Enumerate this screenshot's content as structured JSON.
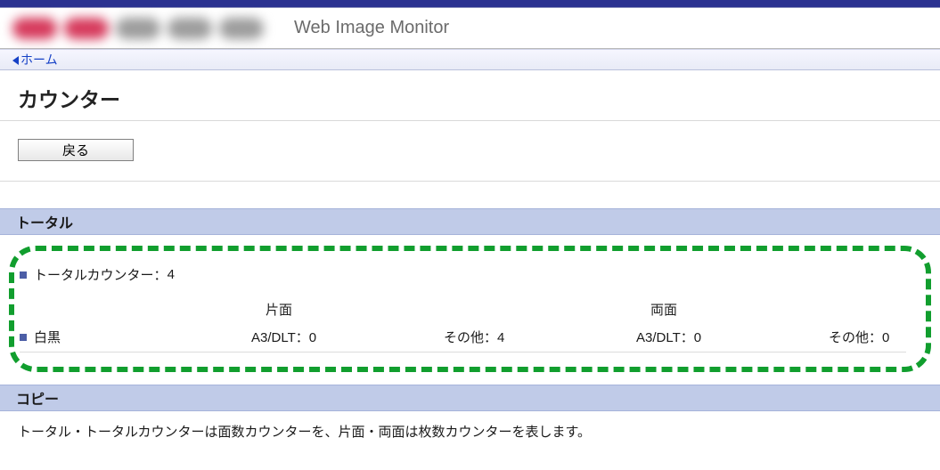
{
  "header": {
    "app_title": "Web Image Monitor"
  },
  "breadcrumb": {
    "home": "ホーム"
  },
  "page": {
    "title": "カウンター",
    "back_button": "戻る"
  },
  "sections": {
    "total": {
      "title": "トータル",
      "total_counter_label": "トータルカウンター：",
      "total_counter_value": "4",
      "col_simplex": "片面",
      "col_duplex": "両面",
      "row_bw_label": "白黒",
      "row_bw": {
        "simplex_a3": "A3/DLT：0",
        "simplex_other": "その他：4",
        "duplex_a3": "A3/DLT：0",
        "duplex_other": "その他：0"
      }
    },
    "copy": {
      "title": "コピー",
      "note": "トータル・トータルカウンターは面数カウンターを、片面・両面は枚数カウンターを表します。"
    }
  }
}
